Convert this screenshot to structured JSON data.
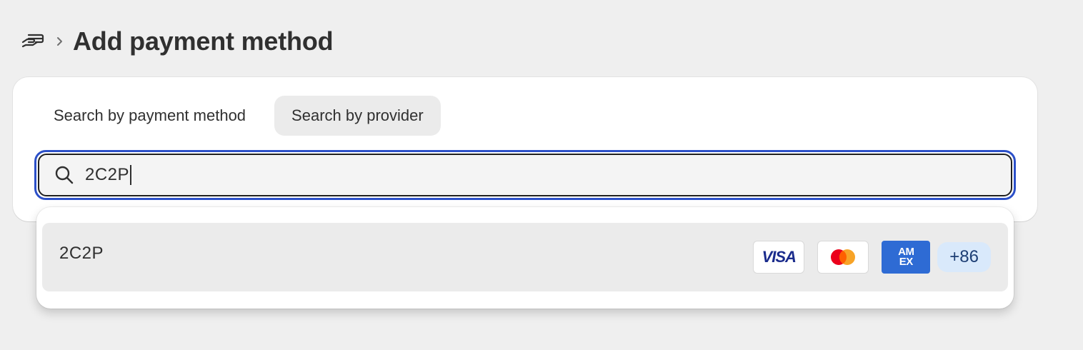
{
  "header": {
    "icon": "payments-hand-icon",
    "title": "Add payment method"
  },
  "tabs": [
    {
      "label": "Search by payment method",
      "active": false
    },
    {
      "label": "Search by provider",
      "active": true
    }
  ],
  "search": {
    "value": "2C2P",
    "focus_color": "#2c50c8"
  },
  "results": [
    {
      "name": "2C2P",
      "logos": [
        "VISA",
        "mastercard",
        "AMERICAN EXPRESS"
      ],
      "more_label": "+86"
    }
  ],
  "logo_text": {
    "visa": "VISA",
    "amex_line1": "AM",
    "amex_line2": "EX"
  }
}
